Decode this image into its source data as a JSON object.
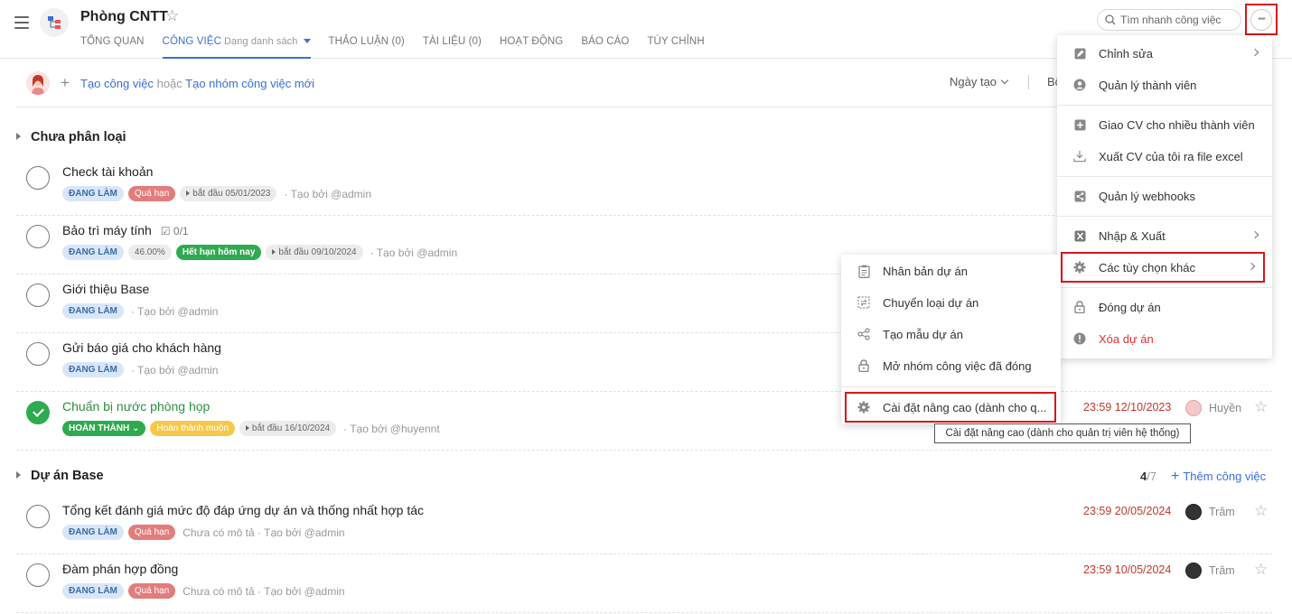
{
  "header": {
    "project_title": "Phòng CNTT",
    "tabs": [
      {
        "label": "TỔNG QUAN"
      },
      {
        "label": "CÔNG VIỆC",
        "sub": "Dạng danh sách"
      },
      {
        "label": "THẢO LUẬN (0)"
      },
      {
        "label": "TÀI LIỆU (0)"
      },
      {
        "label": "HOẠT ĐỘNG"
      },
      {
        "label": "BÁO CÁO"
      },
      {
        "label": "TÙY CHỈNH"
      }
    ],
    "search_placeholder": "Tìm nhanh công việc"
  },
  "create_row": {
    "create_task": "Tạo công việc",
    "or": "hoặc",
    "create_group": "Tạo nhóm công việc mới",
    "sort_label": "Ngày tạo",
    "sort2_label": "Bộ"
  },
  "groups": [
    {
      "name": "Chưa phân loại"
    },
    {
      "name": "Dự án Base",
      "count_done": "4",
      "count_total": "/7",
      "add_label": "Thêm công việc"
    }
  ],
  "tasks": [
    {
      "name": "Check tài khoản",
      "status": "ĐANG LÀM",
      "overdue": "Quá hạn",
      "start": "bắt đầu 05/01/2023",
      "creator": "· Tạo bởi @admin"
    },
    {
      "name": "Bảo trì máy tính",
      "subtasks": "0/1",
      "status": "ĐANG LÀM",
      "percent": "46.00%",
      "due_today": "Hết hạn hôm nay",
      "start": "bắt đầu 09/10/2024",
      "creator": "· Tạo bởi @admin"
    },
    {
      "name": "Giới thiệu Base",
      "status": "ĐANG LÀM",
      "creator": "· Tạo bởi @admin"
    },
    {
      "name": "Gửi báo giá cho khách hàng",
      "status": "ĐANG LÀM",
      "creator": "· Tạo bởi @admin"
    },
    {
      "name": "Chuẩn bị nước phòng họp",
      "status": "HOÀN THÀNH",
      "late": "Hoàn thành muộn",
      "start": "bắt đầu 16/10/2024",
      "creator": "· Tạo bởi @huyennt",
      "due": "23:59 12/10/2023",
      "assignee": "Huyền"
    },
    {
      "name": "Tổng kết đánh giá mức độ đáp ứng dự án và thống nhất hợp tác",
      "status": "ĐANG LÀM",
      "overdue": "Quá hạn",
      "creator": "Chưa có mô tả · Tạo bởi @admin",
      "due": "23:59 20/05/2024",
      "assignee": "Trâm"
    },
    {
      "name": "Đàm phán hợp đồng",
      "status": "ĐANG LÀM",
      "overdue": "Quá hạn",
      "creator": "Chưa có mô tả · Tạo bởi @admin",
      "due": "23:59 10/05/2024",
      "assignee": "Trâm"
    }
  ],
  "menu_main": [
    {
      "label": "Chỉnh sửa",
      "icon": "pencil-icon"
    },
    {
      "label": "Quản lý thành viên",
      "icon": "user-icon"
    },
    {
      "label": "Giao CV cho nhiều thành viên",
      "icon": "plus-square-icon"
    },
    {
      "label": "Xuất CV của tôi ra file excel",
      "icon": "download-icon"
    },
    {
      "label": "Quản lý webhooks",
      "icon": "share-icon"
    },
    {
      "label": "Nhập & Xuất",
      "icon": "excel-icon"
    },
    {
      "label": "Các tùy chọn khác",
      "icon": "gear-icon"
    },
    {
      "label": "Đóng dự án",
      "icon": "lock-icon"
    },
    {
      "label": "Xóa dự án",
      "icon": "alert-icon"
    }
  ],
  "menu_sub": [
    {
      "label": "Nhân bản dự án",
      "icon": "clipboard-icon"
    },
    {
      "label": "Chuyển loại dự án",
      "icon": "transfer-icon"
    },
    {
      "label": "Tạo mẫu dự án",
      "icon": "share-icon"
    },
    {
      "label": "Mở nhóm công việc đã đóng",
      "icon": "unlock-icon"
    },
    {
      "label": "Cài đặt nâng cao (dành cho q...",
      "icon": "gear-icon"
    }
  ],
  "tooltip": "Cài đặt nâng cao (dành cho quản trị viên hệ thống)",
  "colors": {
    "accent": "#3a6fd8",
    "danger": "#d33333",
    "success": "#2fab4f",
    "highlight_box": "#d9161d"
  }
}
